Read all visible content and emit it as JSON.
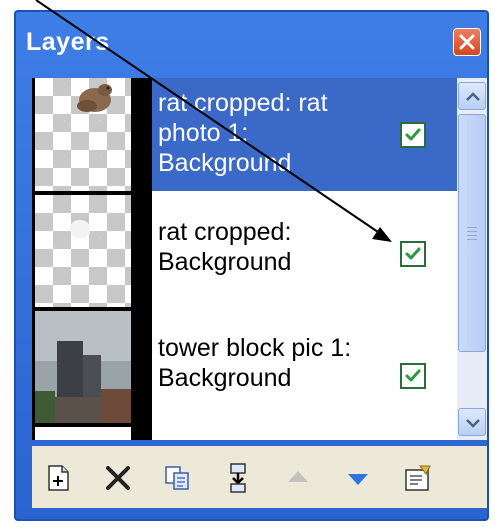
{
  "window": {
    "title": "Layers",
    "close_icon": "close-icon"
  },
  "layers": [
    {
      "label": "rat cropped: rat photo 1: Background",
      "selected": true,
      "visible": true,
      "thumbnail": "rat-photo-thumbnail"
    },
    {
      "label": "rat cropped: Background",
      "selected": false,
      "visible": true,
      "thumbnail": "transparent-layer-thumbnail"
    },
    {
      "label": "tower block pic 1: Background",
      "selected": false,
      "visible": true,
      "thumbnail": "tower-block-thumbnail"
    }
  ],
  "scrollbar": {
    "up_icon": "chevron-up-icon",
    "down_icon": "chevron-down-icon"
  },
  "toolbar": {
    "buttons": [
      "new-layer-icon",
      "delete-layer-icon",
      "duplicate-layer-icon",
      "merge-layer-down-icon",
      "move-layer-up-icon",
      "move-layer-down-icon",
      "layer-properties-icon"
    ]
  },
  "colors": {
    "window_frame": "#2b63d0",
    "selection": "#3a69c8",
    "close_button": "#d2461f",
    "checkmark": "#2a9d3a",
    "annotation_arrow": "#000000"
  }
}
